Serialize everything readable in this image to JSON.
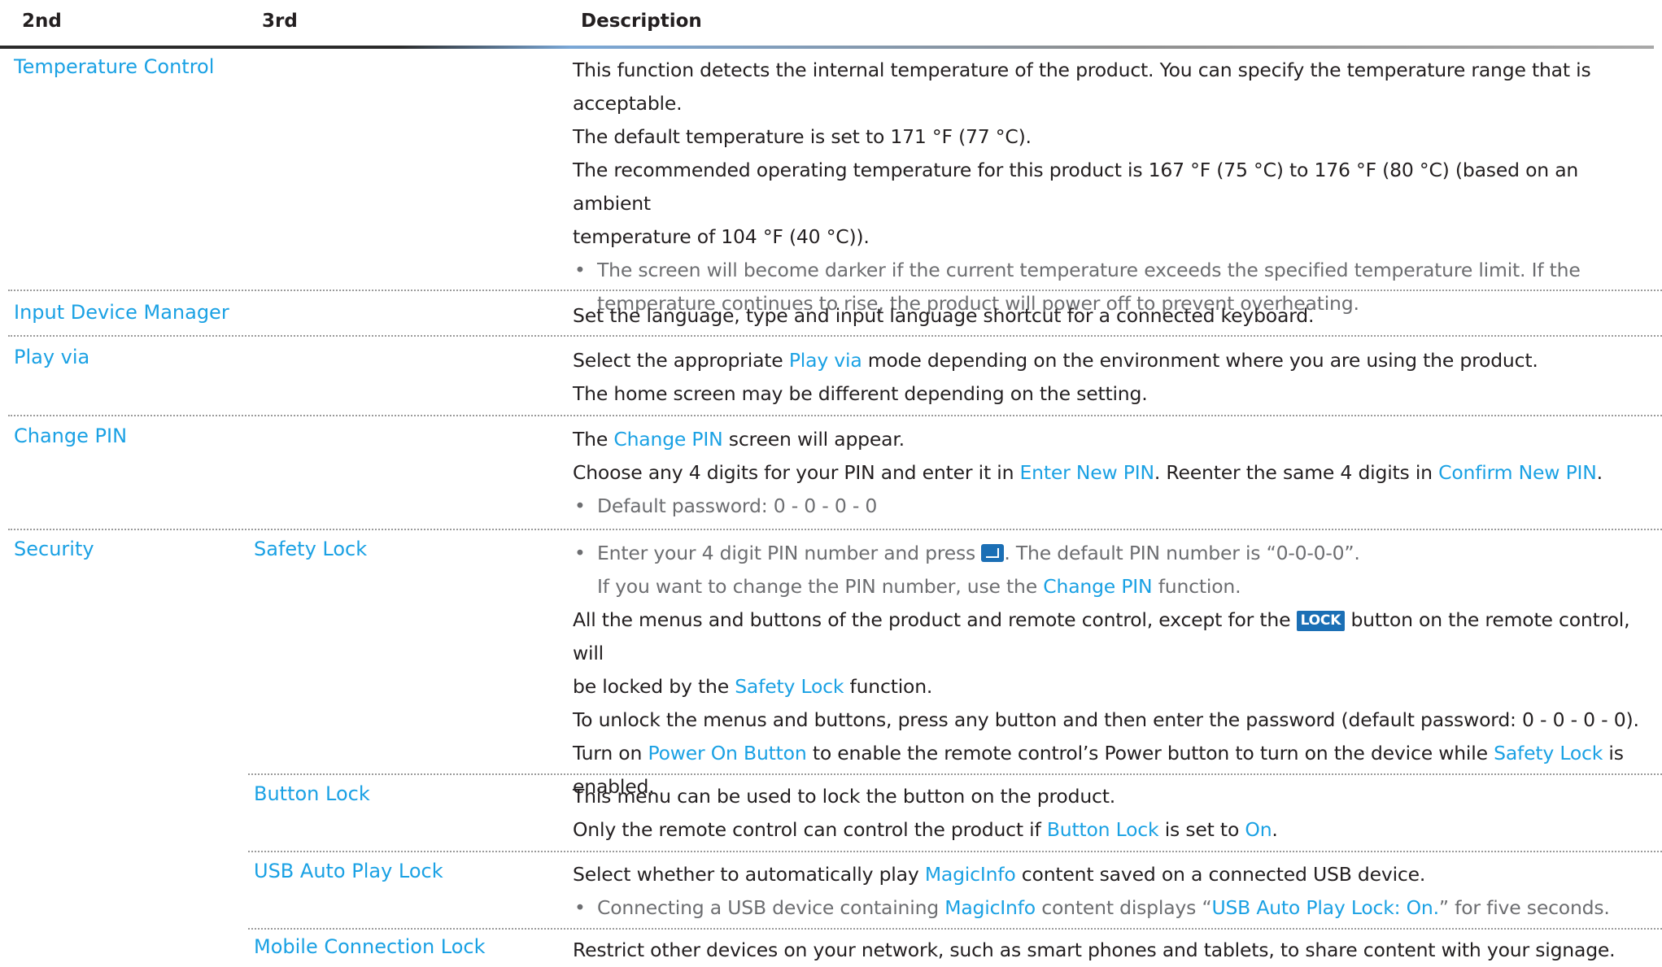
{
  "header": {
    "col_2nd": "2nd",
    "col_3rd": "3rd",
    "col_desc": "Description"
  },
  "temperature": {
    "name": "Temperature Control",
    "line1": "This function detects the internal temperature of the product. You can specify the temperature range that is",
    "line2": "acceptable.",
    "line3": "The default temperature is set to 171 °F (77 °C).",
    "line4": "The recommended operating temperature for this product is 167 °F (75 °C) to 176 °F (80 °C) (based on an ambient",
    "line5": "temperature of 104 °F (40 °C)).",
    "note1": "The screen will become darker if the current temperature exceeds the specified temperature limit. If the",
    "note2": "temperature continues to rise, the product will power off to prevent overheating."
  },
  "input_device": {
    "name": "Input Device Manager",
    "line1": "Set the language, type and input language shortcut for a connected keyboard."
  },
  "play_via": {
    "name": "Play via",
    "l1_a": "Select the appropriate ",
    "l1_b": "Play via",
    "l1_c": " mode depending on the environment where you are using the product.",
    "line2": "The home screen may be different depending on the setting."
  },
  "change_pin": {
    "name": "Change PIN",
    "l1_a": "The ",
    "l1_b": "Change PIN",
    "l1_c": " screen will appear.",
    "l2_a": "Choose any 4 digits for your PIN and enter it in ",
    "l2_b": "Enter New PIN",
    "l2_c": ". Reenter the same 4 digits in ",
    "l2_d": "Confirm New PIN",
    "l2_e": ".",
    "note": "Default password: 0 - 0 - 0 - 0"
  },
  "security": {
    "name": "Security",
    "safety_lock": {
      "name": "Safety Lock",
      "n1_a": "Enter your 4 digit PIN number and press ",
      "n1_b": ". The default PIN number is “0-0-0-0”.",
      "n2_a": "If you want to change the PIN number, use the ",
      "n2_b": "Change PIN",
      "n2_c": " function.",
      "l3_a": "All the menus and buttons of the product and remote control, except for the ",
      "l3_btn": "LOCK",
      "l3_c": " button on the remote control, will",
      "l4_a": "be locked by the ",
      "l4_b": "Safety Lock",
      "l4_c": " function.",
      "line5": "To unlock the menus and buttons, press any button and then enter the password (default password: 0 - 0 - 0 - 0).",
      "l6_a": "Turn on ",
      "l6_b": "Power On Button",
      "l6_c": " to enable the remote control’s Power button to turn on the device while ",
      "l6_d": "Safety Lock",
      "l6_e": " is",
      "line7": "enabled."
    },
    "button_lock": {
      "name": "Button Lock",
      "line1": "This menu can be used to lock the button on the product.",
      "l2_a": "Only the remote control can control the product if ",
      "l2_b": "Button Lock",
      "l2_c": " is set to ",
      "l2_d": "On",
      "l2_e": "."
    },
    "usb_lock": {
      "name": "USB Auto Play Lock",
      "l1_a": "Select whether to automatically play ",
      "l1_b": "MagicInfo",
      "l1_c": " content saved on a connected USB device.",
      "n_a": "Connecting a USB device containing ",
      "n_b": "MagicInfo",
      "n_c": " content displays “",
      "n_d": "USB Auto Play Lock: On.",
      "n_e": "” for five seconds."
    },
    "mobile_lock": {
      "name": "Mobile Connection Lock",
      "line1": "Restrict other devices on your network, such as smart phones and tablets, to share content with your signage."
    }
  }
}
